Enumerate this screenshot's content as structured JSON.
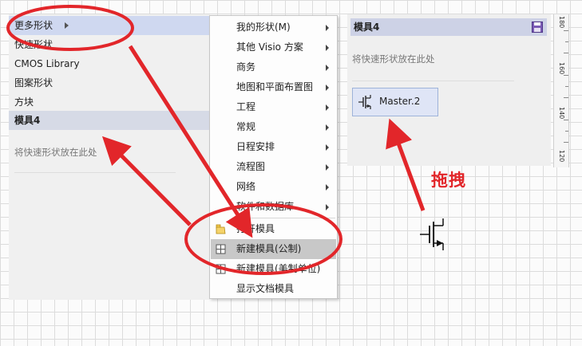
{
  "shapes_panel": {
    "items": [
      {
        "label": "更多形状"
      },
      {
        "label": "快速形状"
      },
      {
        "label": "CMOS Library"
      },
      {
        "label": "图案形状"
      },
      {
        "label": "方块"
      }
    ],
    "stencil_title": "模具4",
    "hint": "将快速形状放在此处"
  },
  "context_menu": {
    "submenu_items": [
      {
        "label": "我的形状(M)"
      },
      {
        "label": "其他 Visio 方案"
      },
      {
        "label": "商务"
      },
      {
        "label": "地图和平面布置图"
      },
      {
        "label": "工程"
      },
      {
        "label": "常规"
      },
      {
        "label": "日程安排"
      },
      {
        "label": "流程图"
      },
      {
        "label": "网络"
      },
      {
        "label": "软件和数据库"
      }
    ],
    "action_items": [
      {
        "label": "打开模具",
        "icon": "open-folder-icon"
      },
      {
        "label": "新建模具(公制)",
        "icon": "grid-icon",
        "highlighted": true
      },
      {
        "label": "新建模具(美制单位)",
        "icon": "grid-icon"
      },
      {
        "label": "显示文档模具",
        "icon": ""
      }
    ]
  },
  "stencil_panel": {
    "title": "模具4",
    "hint": "将快速形状放在此处",
    "master_label": "Master.2",
    "save_icon": "save-icon"
  },
  "ruler": {
    "labels": [
      "180",
      "160",
      "140",
      "120"
    ]
  },
  "annotation": {
    "drag_label": "拖拽",
    "color": "#e2262a"
  }
}
